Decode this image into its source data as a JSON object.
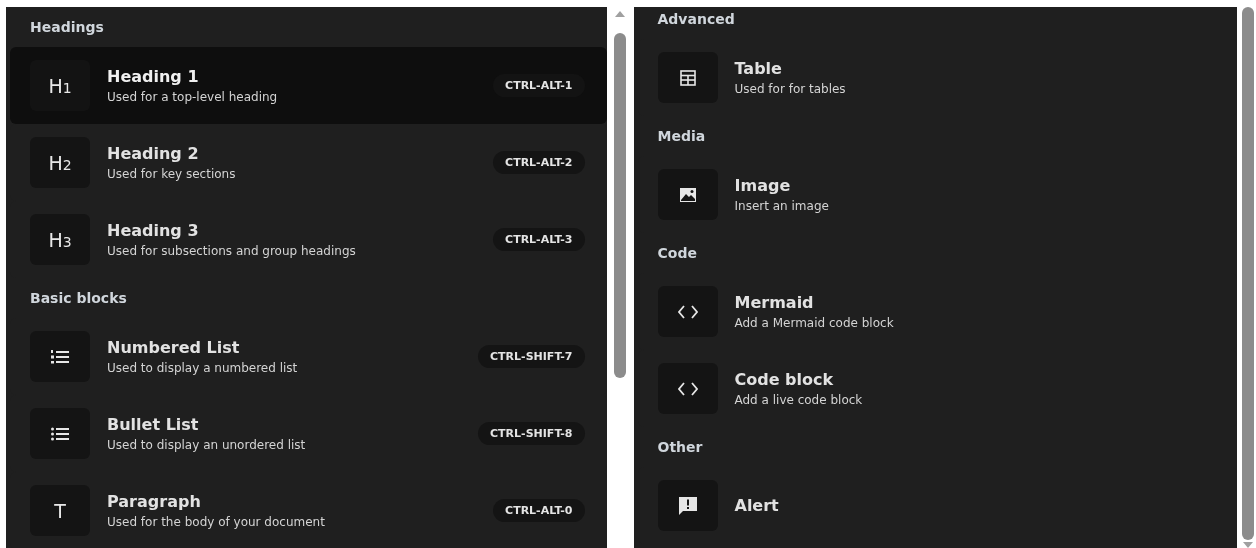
{
  "panels": [
    {
      "sections": [
        {
          "title": "Headings",
          "items": [
            {
              "kind": "text",
              "icon_label": "H$_{1}$",
              "title": "Heading 1",
              "description": "Used for a top-level heading",
              "shortcut": "CTRL-ALT-1",
              "selected": true
            },
            {
              "kind": "text",
              "icon_label": "H$_{2}$",
              "title": "Heading 2",
              "description": "Used for key sections",
              "shortcut": "CTRL-ALT-2",
              "selected": false
            },
            {
              "kind": "text",
              "icon_label": "H$_{3}$",
              "title": "Heading 3",
              "description": "Used for subsections and group headings",
              "shortcut": "CTRL-ALT-3",
              "selected": false
            }
          ]
        },
        {
          "title": "Basic blocks",
          "items": [
            {
              "kind": "numbered-list",
              "title": "Numbered List",
              "description": "Used to display a numbered list",
              "shortcut": "CTRL-SHIFT-7",
              "selected": false
            },
            {
              "kind": "bullet-list",
              "title": "Bullet List",
              "description": "Used to display an unordered list",
              "shortcut": "CTRL-SHIFT-8",
              "selected": false
            },
            {
              "kind": "text",
              "icon_label": "T",
              "title": "Paragraph",
              "description": "Used for the body of your document",
              "shortcut": "CTRL-ALT-0",
              "selected": false
            }
          ]
        }
      ]
    },
    {
      "sections": [
        {
          "title": "Advanced",
          "items": [
            {
              "kind": "table",
              "title": "Table",
              "description": "Used for for tables",
              "selected": false
            }
          ]
        },
        {
          "title": "Media",
          "items": [
            {
              "kind": "image",
              "title": "Image",
              "description": "Insert an image",
              "selected": false
            }
          ]
        },
        {
          "title": "Code",
          "items": [
            {
              "kind": "code",
              "title": "Mermaid",
              "description": "Add a Mermaid code block",
              "selected": false
            },
            {
              "kind": "code",
              "title": "Code block",
              "description": "Add a live code block",
              "selected": false
            }
          ]
        },
        {
          "title": "Other",
          "items": [
            {
              "kind": "alert",
              "title": "Alert",
              "selected": false
            }
          ]
        }
      ]
    }
  ]
}
